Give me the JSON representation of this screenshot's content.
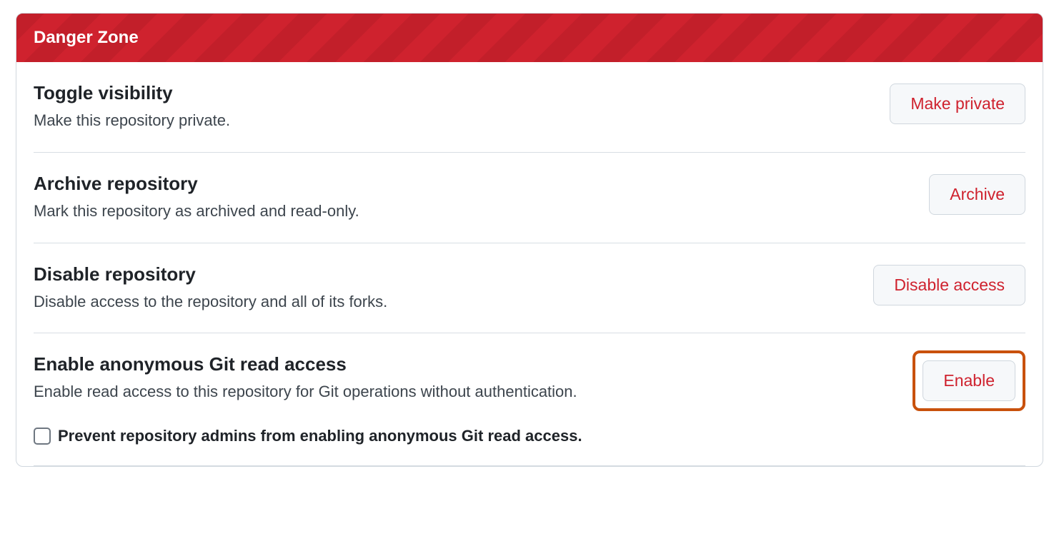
{
  "header": {
    "title": "Danger Zone"
  },
  "items": [
    {
      "title": "Toggle visibility",
      "desc": "Make this repository private.",
      "button": "Make private"
    },
    {
      "title": "Archive repository",
      "desc": "Mark this repository as archived and read-only.",
      "button": "Archive"
    },
    {
      "title": "Disable repository",
      "desc": "Disable access to the repository and all of its forks.",
      "button": "Disable access"
    }
  ],
  "anonymous": {
    "title": "Enable anonymous Git read access",
    "desc": "Enable read access to this repository for Git operations without authentication.",
    "button": "Enable",
    "checkbox_label": "Prevent repository admins from enabling anonymous Git read access."
  }
}
